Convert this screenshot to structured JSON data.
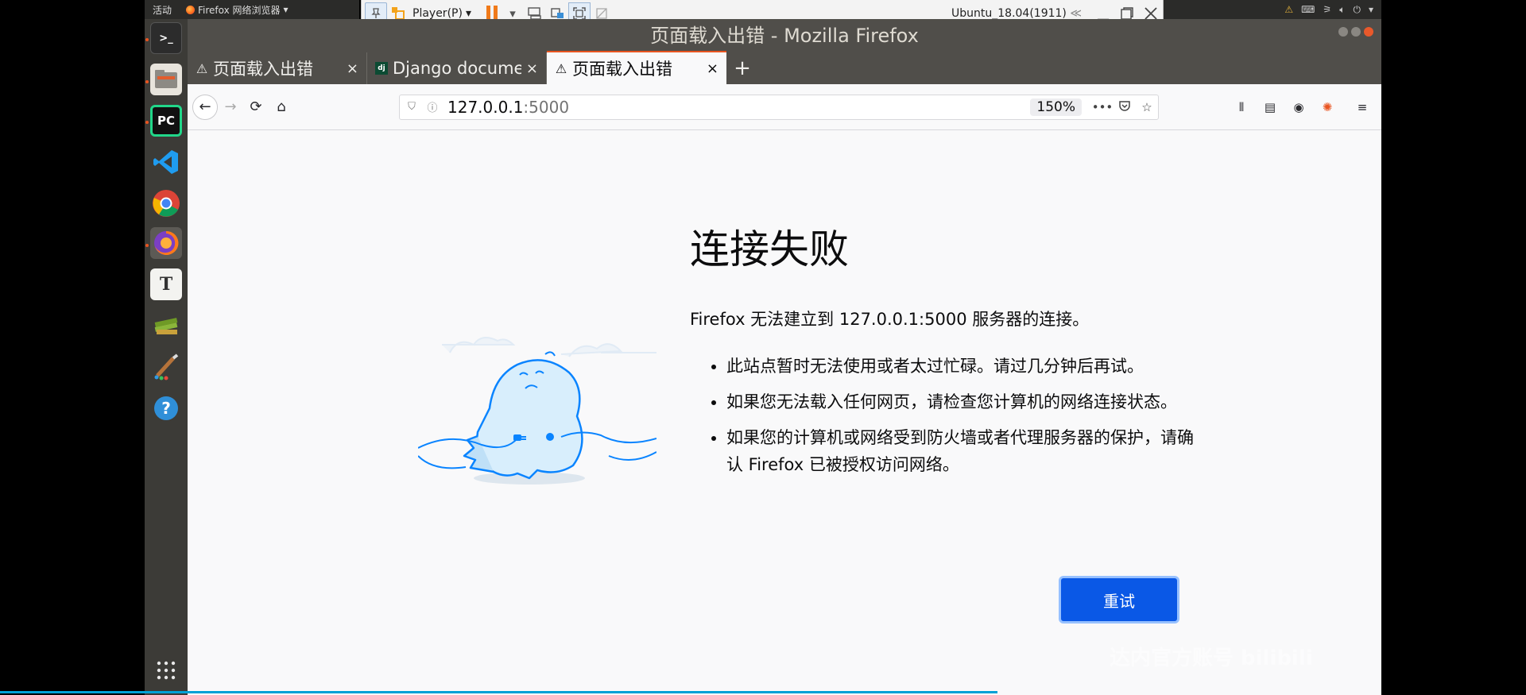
{
  "ubuntu_topbar": {
    "activities": "活动",
    "app_menu": "Firefox 网络浏览器",
    "app_menu_arrow": "▾"
  },
  "vm_toolbar": {
    "player_menu": "Player(P)",
    "vm_name": "Ubuntu_18.04(1911)",
    "collapse": "≪"
  },
  "firefox": {
    "window_title": "页面载入出错 - Mozilla Firefox",
    "tabs": [
      {
        "label": "页面载入出错",
        "icon": "warning-icon",
        "active": false
      },
      {
        "label": "Django documen",
        "icon": "django-favicon",
        "active": false
      },
      {
        "label": "页面载入出错",
        "icon": "warning-icon",
        "active": true
      }
    ],
    "url_host": "127.0.0.1",
    "url_port": ":5000",
    "zoom": "150%"
  },
  "error_page": {
    "title": "连接失败",
    "description": "Firefox 无法建立到 127.0.0.1:5000 服务器的连接。",
    "bullets": [
      "此站点暂时无法使用或者太过忙碌。请过几分钟后再试。",
      "如果您无法载入任何网页，请检查您计算机的网络连接状态。",
      "如果您的计算机或网络受到防火墙或者代理服务器的保护，请确认 Firefox 已被授权访问网络。"
    ],
    "retry_button": "重试"
  },
  "watermark": "达内官方账号 bilibili",
  "colors": {
    "accent": "#e95420",
    "retry_blue": "#0a58e6",
    "titlebar": "#504e4a",
    "dock": "#3c3b37"
  }
}
